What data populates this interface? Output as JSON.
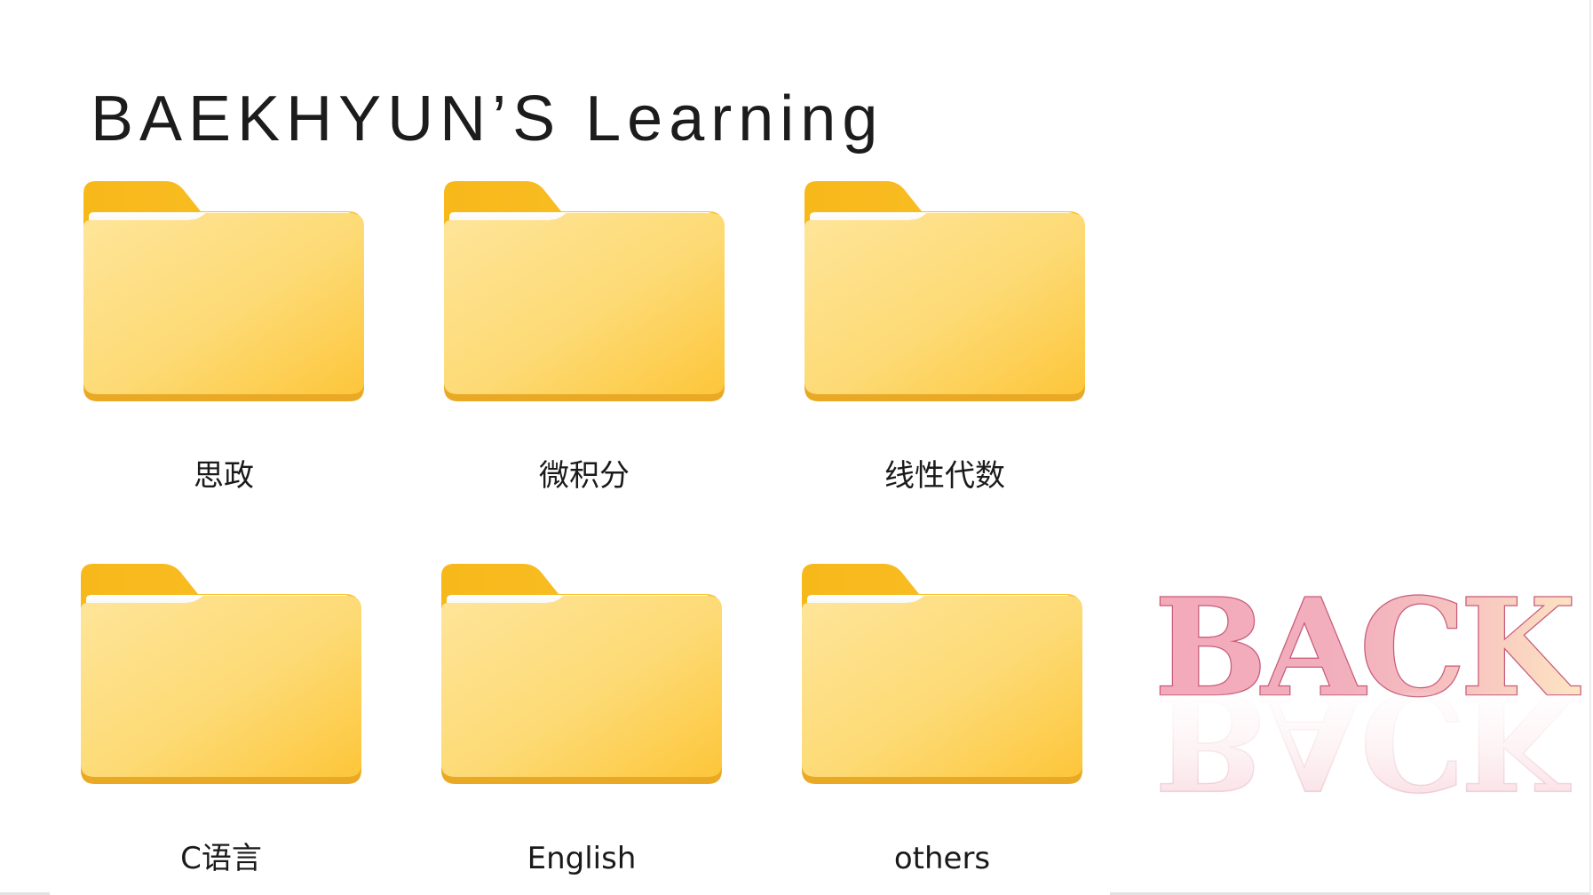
{
  "page": {
    "title": "BAEKHYUN’S Learning"
  },
  "folders": [
    {
      "label": "思政"
    },
    {
      "label": "微积分"
    },
    {
      "label": "线性代数"
    },
    {
      "label": "C语言"
    },
    {
      "label": "English"
    },
    {
      "label": "others"
    }
  ],
  "back_button": {
    "label": "BACK"
  },
  "icons": {
    "folder": "folder-icon"
  },
  "colors": {
    "background": "#ffffff",
    "title_text": "#1c1c1c",
    "folder_tab": "#f9bd1e",
    "folder_body_light": "#fde28e",
    "folder_body_dark": "#fdc83d",
    "folder_bottom_edge": "#e9a924",
    "back_pink": "#f4a6b8",
    "back_cream": "#fde6c0"
  }
}
